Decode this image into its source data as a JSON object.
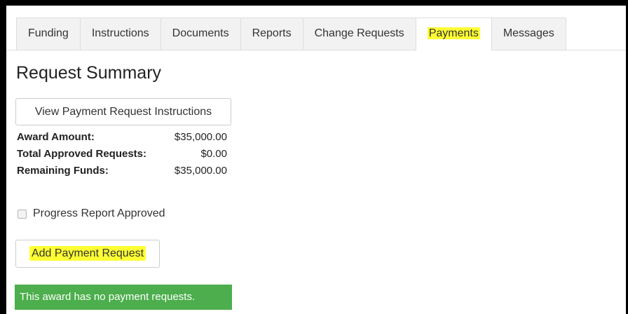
{
  "tabs": [
    {
      "label": "Funding",
      "active": false,
      "highlighted": false
    },
    {
      "label": "Instructions",
      "active": false,
      "highlighted": false
    },
    {
      "label": "Documents",
      "active": false,
      "highlighted": false
    },
    {
      "label": "Reports",
      "active": false,
      "highlighted": false
    },
    {
      "label": "Change Requests",
      "active": false,
      "highlighted": false
    },
    {
      "label": "Payments",
      "active": true,
      "highlighted": true
    },
    {
      "label": "Messages",
      "active": false,
      "highlighted": false
    }
  ],
  "page": {
    "title": "Request Summary"
  },
  "buttons": {
    "view_instructions_label": "View Payment Request Instructions",
    "add_payment_label": "Add Payment Request"
  },
  "summary": [
    {
      "label": "Award Amount:",
      "value": "$35,000.00"
    },
    {
      "label": "Total Approved Requests:",
      "value": "$0.00"
    },
    {
      "label": "Remaining Funds:",
      "value": "$35,000.00"
    }
  ],
  "checkbox": {
    "label": "Progress Report Approved",
    "checked": false
  },
  "alert": {
    "text": "This award has no payment requests."
  },
  "colors": {
    "highlight": "#ffff33",
    "alert_background": "#4cae4c",
    "tab_inactive_background": "#f2f2f2"
  }
}
